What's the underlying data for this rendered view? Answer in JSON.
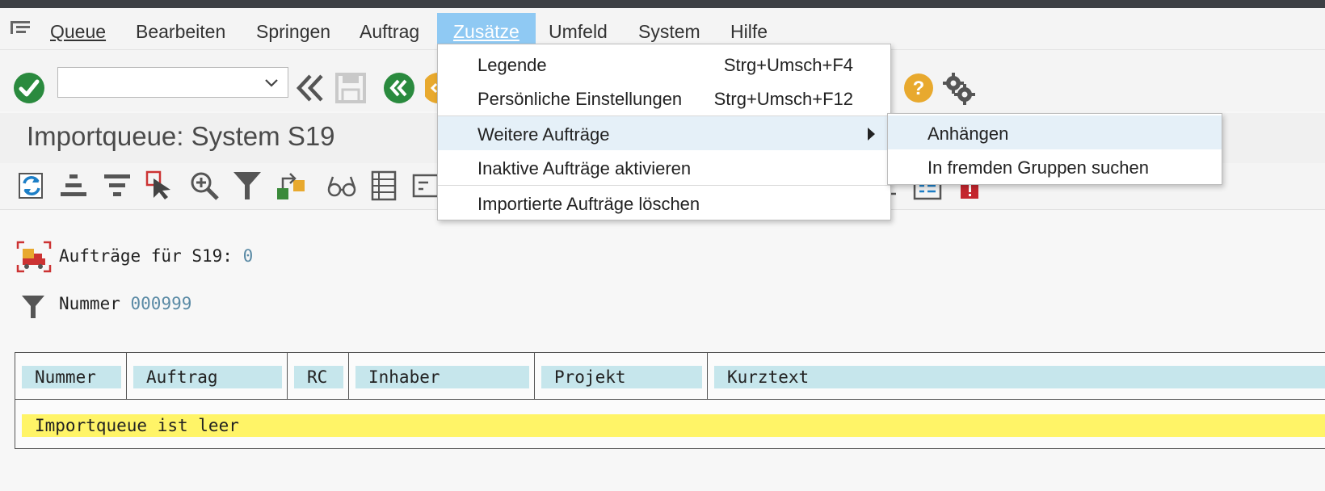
{
  "menubar": {
    "items": [
      {
        "label": "Queue"
      },
      {
        "label": "Bearbeiten"
      },
      {
        "label": "Springen"
      },
      {
        "label": "Auftrag"
      },
      {
        "label": "Zusätze"
      },
      {
        "label": "Umfeld"
      },
      {
        "label": "System"
      },
      {
        "label": "Hilfe"
      }
    ],
    "active_index": 4
  },
  "command_field": {
    "value": ""
  },
  "title": "Importqueue: System S19",
  "info": {
    "requests_label": "Aufträge für S19:",
    "requests_value": "0",
    "number_label": "Nummer",
    "number_value": "000999"
  },
  "grid": {
    "columns": [
      "Nummer",
      "Auftrag",
      "RC",
      "Inhaber",
      "Projekt",
      "Kurztext"
    ],
    "empty_message": "Importqueue ist leer"
  },
  "menu_zusaetze": {
    "items": [
      {
        "label": "Legende",
        "shortcut": "Strg+Umsch+F4"
      },
      {
        "label": "Persönliche Einstellungen",
        "shortcut": "Strg+Umsch+F12"
      },
      {
        "label": "Weitere Aufträge",
        "shortcut": ""
      },
      {
        "label": "Inaktive Aufträge aktivieren",
        "shortcut": ""
      },
      {
        "label": "Importierte Aufträge löschen",
        "shortcut": ""
      }
    ]
  },
  "submenu_weitere": {
    "items": [
      {
        "label": "Anhängen"
      },
      {
        "label": "In fremden Gruppen suchen"
      }
    ]
  },
  "colors": {
    "menu_active": "#8fc9f3",
    "ok_green": "#2a8a3e",
    "help_orange": "#e8a92e",
    "header_cell": "#c6e6ec",
    "empty_row": "#fff467",
    "menu_highlight": "#e5f0f8"
  },
  "icons": {
    "toolbar1": [
      "enter-icon",
      "command-dropdown-icon",
      "back-icon",
      "save-icon",
      "previous-green-icon",
      "orange-nav-icon",
      "help-icon",
      "settings-gear-icon"
    ],
    "toolbar2": [
      "refresh-icon",
      "sort-ascending-icon",
      "sort-descending-icon",
      "select-icon",
      "zoom-icon",
      "filter-icon",
      "transport-icon",
      "display-icon",
      "list-icon",
      "structure-icon",
      "document-icon",
      "red-flag-icon"
    ]
  }
}
